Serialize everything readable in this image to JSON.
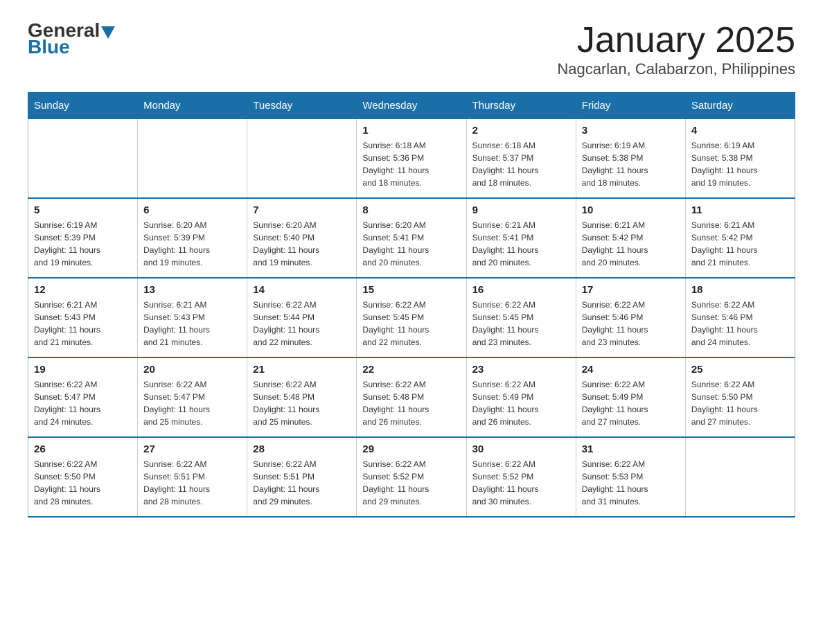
{
  "logo": {
    "general": "General",
    "blue": "Blue",
    "triangle": "▲"
  },
  "title": "January 2025",
  "subtitle": "Nagcarlan, Calabarzon, Philippines",
  "header_days": [
    "Sunday",
    "Monday",
    "Tuesday",
    "Wednesday",
    "Thursday",
    "Friday",
    "Saturday"
  ],
  "weeks": [
    [
      {
        "day": "",
        "info": ""
      },
      {
        "day": "",
        "info": ""
      },
      {
        "day": "",
        "info": ""
      },
      {
        "day": "1",
        "info": "Sunrise: 6:18 AM\nSunset: 5:36 PM\nDaylight: 11 hours\nand 18 minutes."
      },
      {
        "day": "2",
        "info": "Sunrise: 6:18 AM\nSunset: 5:37 PM\nDaylight: 11 hours\nand 18 minutes."
      },
      {
        "day": "3",
        "info": "Sunrise: 6:19 AM\nSunset: 5:38 PM\nDaylight: 11 hours\nand 18 minutes."
      },
      {
        "day": "4",
        "info": "Sunrise: 6:19 AM\nSunset: 5:38 PM\nDaylight: 11 hours\nand 19 minutes."
      }
    ],
    [
      {
        "day": "5",
        "info": "Sunrise: 6:19 AM\nSunset: 5:39 PM\nDaylight: 11 hours\nand 19 minutes."
      },
      {
        "day": "6",
        "info": "Sunrise: 6:20 AM\nSunset: 5:39 PM\nDaylight: 11 hours\nand 19 minutes."
      },
      {
        "day": "7",
        "info": "Sunrise: 6:20 AM\nSunset: 5:40 PM\nDaylight: 11 hours\nand 19 minutes."
      },
      {
        "day": "8",
        "info": "Sunrise: 6:20 AM\nSunset: 5:41 PM\nDaylight: 11 hours\nand 20 minutes."
      },
      {
        "day": "9",
        "info": "Sunrise: 6:21 AM\nSunset: 5:41 PM\nDaylight: 11 hours\nand 20 minutes."
      },
      {
        "day": "10",
        "info": "Sunrise: 6:21 AM\nSunset: 5:42 PM\nDaylight: 11 hours\nand 20 minutes."
      },
      {
        "day": "11",
        "info": "Sunrise: 6:21 AM\nSunset: 5:42 PM\nDaylight: 11 hours\nand 21 minutes."
      }
    ],
    [
      {
        "day": "12",
        "info": "Sunrise: 6:21 AM\nSunset: 5:43 PM\nDaylight: 11 hours\nand 21 minutes."
      },
      {
        "day": "13",
        "info": "Sunrise: 6:21 AM\nSunset: 5:43 PM\nDaylight: 11 hours\nand 21 minutes."
      },
      {
        "day": "14",
        "info": "Sunrise: 6:22 AM\nSunset: 5:44 PM\nDaylight: 11 hours\nand 22 minutes."
      },
      {
        "day": "15",
        "info": "Sunrise: 6:22 AM\nSunset: 5:45 PM\nDaylight: 11 hours\nand 22 minutes."
      },
      {
        "day": "16",
        "info": "Sunrise: 6:22 AM\nSunset: 5:45 PM\nDaylight: 11 hours\nand 23 minutes."
      },
      {
        "day": "17",
        "info": "Sunrise: 6:22 AM\nSunset: 5:46 PM\nDaylight: 11 hours\nand 23 minutes."
      },
      {
        "day": "18",
        "info": "Sunrise: 6:22 AM\nSunset: 5:46 PM\nDaylight: 11 hours\nand 24 minutes."
      }
    ],
    [
      {
        "day": "19",
        "info": "Sunrise: 6:22 AM\nSunset: 5:47 PM\nDaylight: 11 hours\nand 24 minutes."
      },
      {
        "day": "20",
        "info": "Sunrise: 6:22 AM\nSunset: 5:47 PM\nDaylight: 11 hours\nand 25 minutes."
      },
      {
        "day": "21",
        "info": "Sunrise: 6:22 AM\nSunset: 5:48 PM\nDaylight: 11 hours\nand 25 minutes."
      },
      {
        "day": "22",
        "info": "Sunrise: 6:22 AM\nSunset: 5:48 PM\nDaylight: 11 hours\nand 26 minutes."
      },
      {
        "day": "23",
        "info": "Sunrise: 6:22 AM\nSunset: 5:49 PM\nDaylight: 11 hours\nand 26 minutes."
      },
      {
        "day": "24",
        "info": "Sunrise: 6:22 AM\nSunset: 5:49 PM\nDaylight: 11 hours\nand 27 minutes."
      },
      {
        "day": "25",
        "info": "Sunrise: 6:22 AM\nSunset: 5:50 PM\nDaylight: 11 hours\nand 27 minutes."
      }
    ],
    [
      {
        "day": "26",
        "info": "Sunrise: 6:22 AM\nSunset: 5:50 PM\nDaylight: 11 hours\nand 28 minutes."
      },
      {
        "day": "27",
        "info": "Sunrise: 6:22 AM\nSunset: 5:51 PM\nDaylight: 11 hours\nand 28 minutes."
      },
      {
        "day": "28",
        "info": "Sunrise: 6:22 AM\nSunset: 5:51 PM\nDaylight: 11 hours\nand 29 minutes."
      },
      {
        "day": "29",
        "info": "Sunrise: 6:22 AM\nSunset: 5:52 PM\nDaylight: 11 hours\nand 29 minutes."
      },
      {
        "day": "30",
        "info": "Sunrise: 6:22 AM\nSunset: 5:52 PM\nDaylight: 11 hours\nand 30 minutes."
      },
      {
        "day": "31",
        "info": "Sunrise: 6:22 AM\nSunset: 5:53 PM\nDaylight: 11 hours\nand 31 minutes."
      },
      {
        "day": "",
        "info": ""
      }
    ]
  ]
}
